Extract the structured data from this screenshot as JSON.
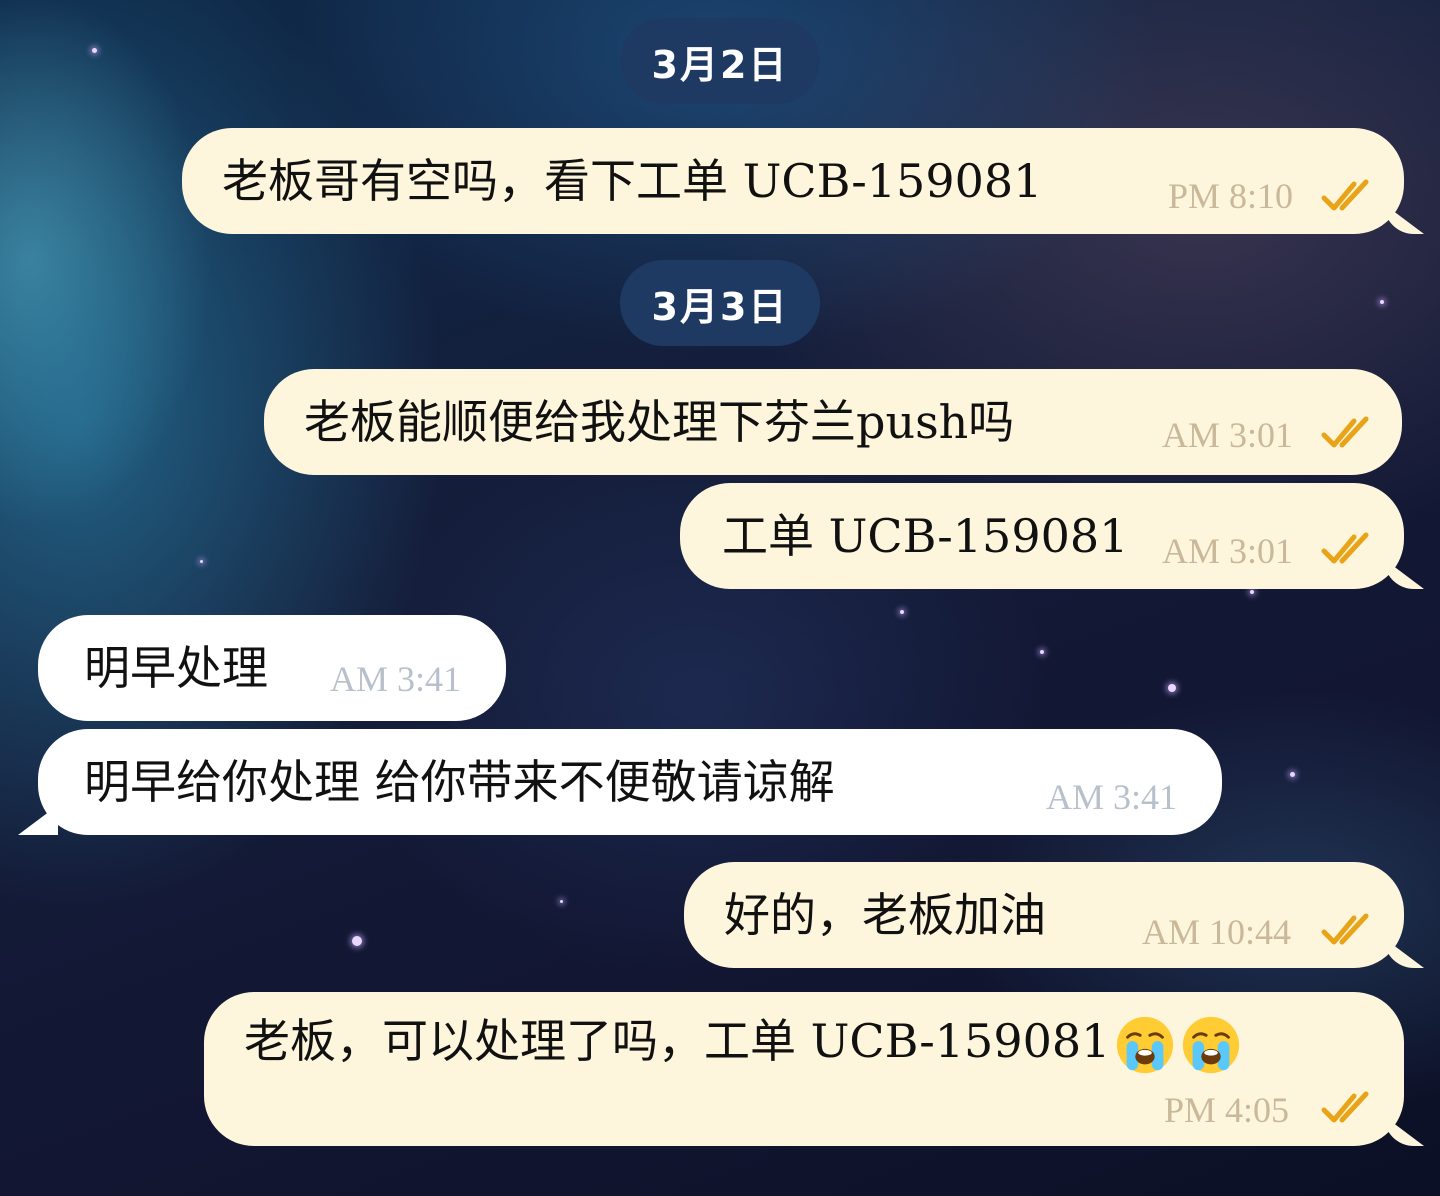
{
  "colors": {
    "outgoing_bubble": "#fdf5dc",
    "incoming_bubble": "#ffffff",
    "date_pill": "#1e3a63",
    "read_check": "#e8a317"
  },
  "dates": [
    {
      "label": "3月2日"
    },
    {
      "label": "3月3日"
    }
  ],
  "messages": [
    {
      "direction": "outgoing",
      "text": "老板哥有空吗，看下工单 UCB-159081",
      "time": "PM  8:10",
      "status": "read-double-check-icon"
    },
    {
      "direction": "outgoing",
      "text": "老板能顺便给我处理下芬兰push吗",
      "time": "AM  3:01",
      "status": "read-double-check-icon"
    },
    {
      "direction": "outgoing",
      "text": "工单 UCB-159081",
      "time": "AM  3:01",
      "status": "read-double-check-icon"
    },
    {
      "direction": "incoming",
      "text": "明早处理",
      "time": "AM  3:41"
    },
    {
      "direction": "incoming",
      "text": "明早给你处理  给你带来不便敬请谅解",
      "time": "AM  3:41"
    },
    {
      "direction": "outgoing",
      "text": "好的，老板加油",
      "time": "AM  10:44",
      "status": "read-double-check-icon"
    },
    {
      "direction": "outgoing",
      "text": "老板，可以处理了吗，工单 UCB-159081",
      "emoji": [
        "crying-face-icon",
        "crying-face-icon"
      ],
      "time": "PM  4:05",
      "status": "read-double-check-icon"
    }
  ]
}
